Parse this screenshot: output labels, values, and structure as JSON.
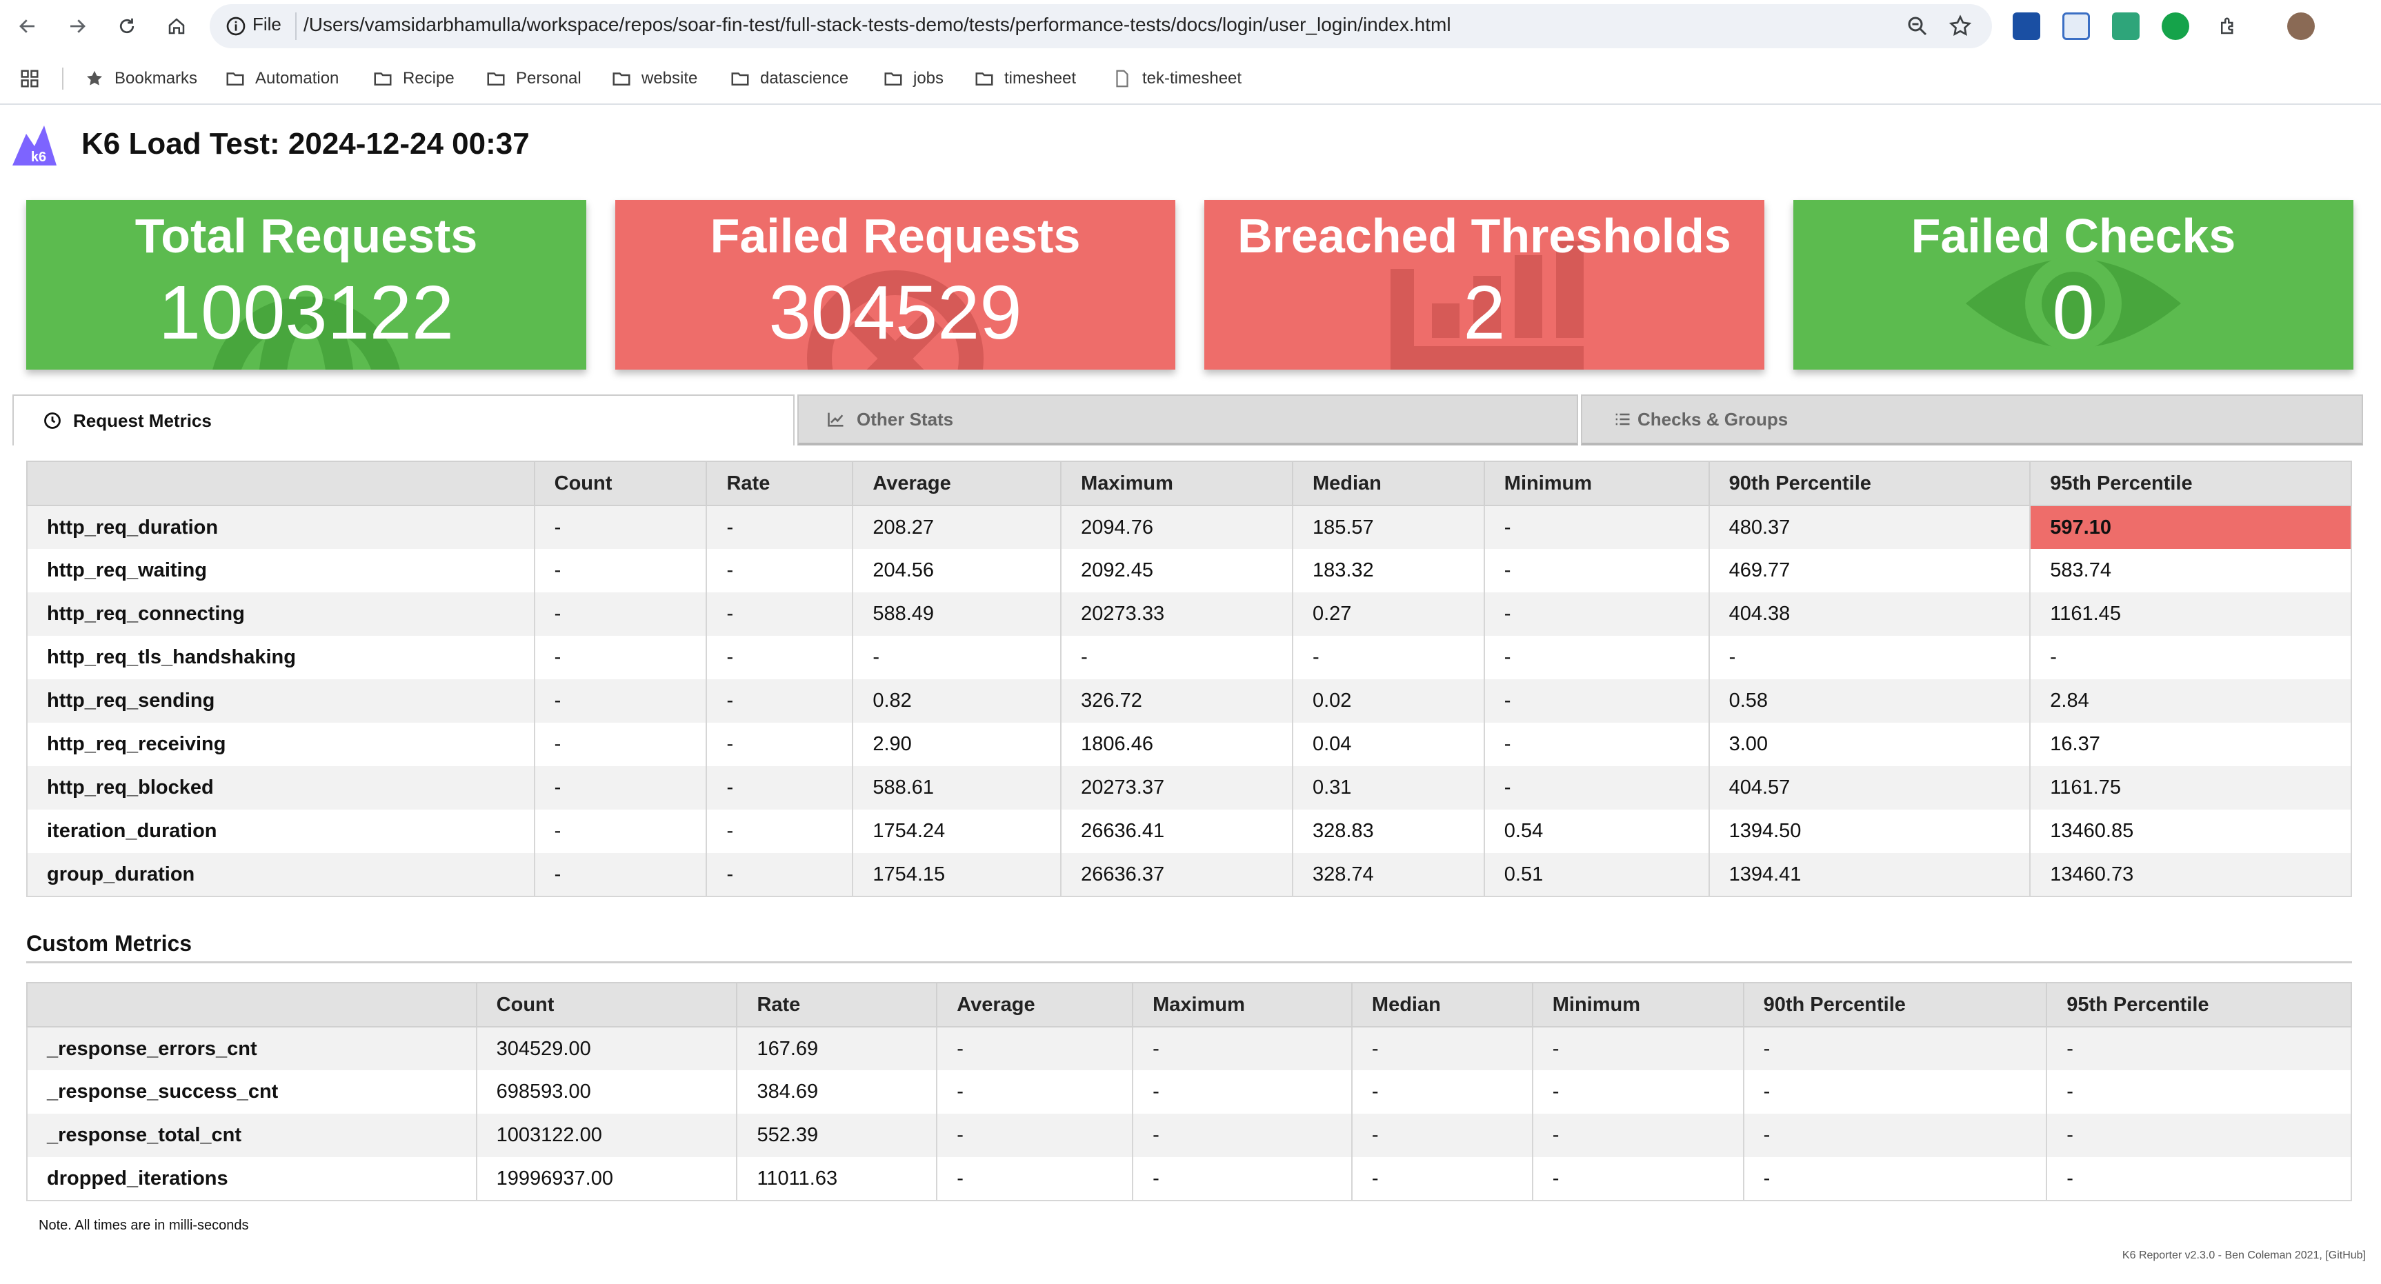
{
  "browser": {
    "omnibox": {
      "scheme_label": "File",
      "url": "/Users/vamsidarbhamulla/workspace/repos/soar-fin-test/full-stack-tests-demo/tests/performance-tests/docs/login/user_login/index.html"
    },
    "bookmarks": [
      "Bookmarks",
      "Automation",
      "Recipe",
      "Personal",
      "website",
      "datascience",
      "jobs",
      "timesheet",
      "tek-timesheet"
    ]
  },
  "report": {
    "logo_text": "k6",
    "title": "K6 Load Test: 2024-12-24 00:37",
    "cards": [
      {
        "title": "Total Requests",
        "value": "1003122",
        "status": "pass",
        "icon": "globe-icon"
      },
      {
        "title": "Failed Requests",
        "value": "304529",
        "status": "fail",
        "icon": "x-circle-icon"
      },
      {
        "title": "Breached Thresholds",
        "value": "2",
        "status": "fail",
        "icon": "bar-chart-icon"
      },
      {
        "title": "Failed Checks",
        "value": "0",
        "status": "pass",
        "icon": "eye-icon"
      }
    ],
    "colors": {
      "pass": "#5cbb4f",
      "fail": "#ee6d6a"
    },
    "tabs": [
      {
        "label": "Request Metrics",
        "icon": "clock-icon",
        "active": true
      },
      {
        "label": "Other Stats",
        "icon": "line-chart-icon",
        "active": false
      },
      {
        "label": "Checks & Groups",
        "icon": "list-icon",
        "active": false
      }
    ],
    "request_metrics": {
      "headers": [
        "",
        "Count",
        "Rate",
        "Average",
        "Maximum",
        "Median",
        "Minimum",
        "90th Percentile",
        "95th Percentile"
      ],
      "rows": [
        [
          "http_req_duration",
          "-",
          "-",
          "208.27",
          "2094.76",
          "185.57",
          "-",
          "480.37",
          "597.10"
        ],
        [
          "http_req_waiting",
          "-",
          "-",
          "204.56",
          "2092.45",
          "183.32",
          "-",
          "469.77",
          "583.74"
        ],
        [
          "http_req_connecting",
          "-",
          "-",
          "588.49",
          "20273.33",
          "0.27",
          "-",
          "404.38",
          "1161.45"
        ],
        [
          "http_req_tls_handshaking",
          "-",
          "-",
          "-",
          "-",
          "-",
          "-",
          "-",
          "-"
        ],
        [
          "http_req_sending",
          "-",
          "-",
          "0.82",
          "326.72",
          "0.02",
          "-",
          "0.58",
          "2.84"
        ],
        [
          "http_req_receiving",
          "-",
          "-",
          "2.90",
          "1806.46",
          "0.04",
          "-",
          "3.00",
          "16.37"
        ],
        [
          "http_req_blocked",
          "-",
          "-",
          "588.61",
          "20273.37",
          "0.31",
          "-",
          "404.57",
          "1161.75"
        ],
        [
          "iteration_duration",
          "-",
          "-",
          "1754.24",
          "26636.41",
          "328.83",
          "0.54",
          "1394.50",
          "13460.85"
        ],
        [
          "group_duration",
          "-",
          "-",
          "1754.15",
          "26636.37",
          "328.74",
          "0.51",
          "1394.41",
          "13460.73"
        ]
      ],
      "failed_cells": [
        [
          0,
          8
        ]
      ]
    },
    "custom_metrics": {
      "title": "Custom Metrics",
      "headers": [
        "",
        "Count",
        "Rate",
        "Average",
        "Maximum",
        "Median",
        "Minimum",
        "90th Percentile",
        "95th Percentile"
      ],
      "rows": [
        [
          "_response_errors_cnt",
          "304529.00",
          "167.69",
          "-",
          "-",
          "-",
          "-",
          "-",
          "-"
        ],
        [
          "_response_success_cnt",
          "698593.00",
          "384.69",
          "-",
          "-",
          "-",
          "-",
          "-",
          "-"
        ],
        [
          "_response_total_cnt",
          "1003122.00",
          "552.39",
          "-",
          "-",
          "-",
          "-",
          "-",
          "-"
        ],
        [
          "dropped_iterations",
          "19996937.00",
          "11011.63",
          "-",
          "-",
          "-",
          "-",
          "-",
          "-"
        ]
      ]
    },
    "note": "Note. All times are in milli-seconds",
    "footer": "K6 Reporter v2.3.0 - Ben Coleman 2021, [GitHub]"
  }
}
